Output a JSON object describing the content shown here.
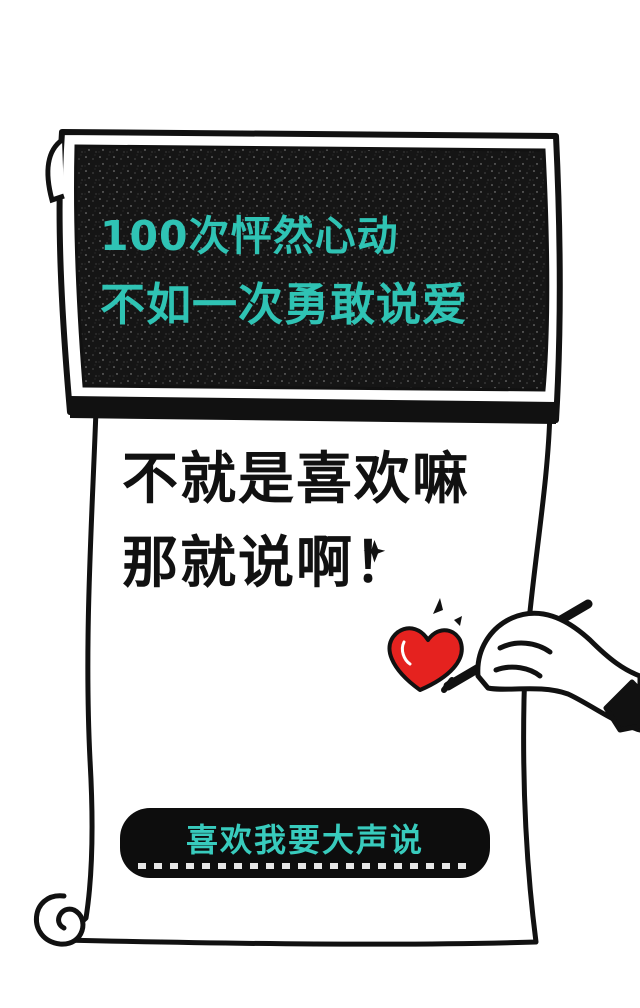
{
  "banner": {
    "line_1": "100次怦然心动",
    "line_2": "不如一次勇敢说爱"
  },
  "slogan": {
    "line_1": "不就是喜欢嘛",
    "line_2": "那就说啊！"
  },
  "cta": {
    "label": "喜欢我要大声说"
  },
  "icons": [
    "heart-icon",
    "sparkle-icon",
    "hand-with-pen-icon"
  ],
  "colors": {
    "accent_teal": "#2fc3b4",
    "ink_black": "#111111",
    "heart_red": "#e5221f",
    "paper_white": "#ffffff"
  }
}
